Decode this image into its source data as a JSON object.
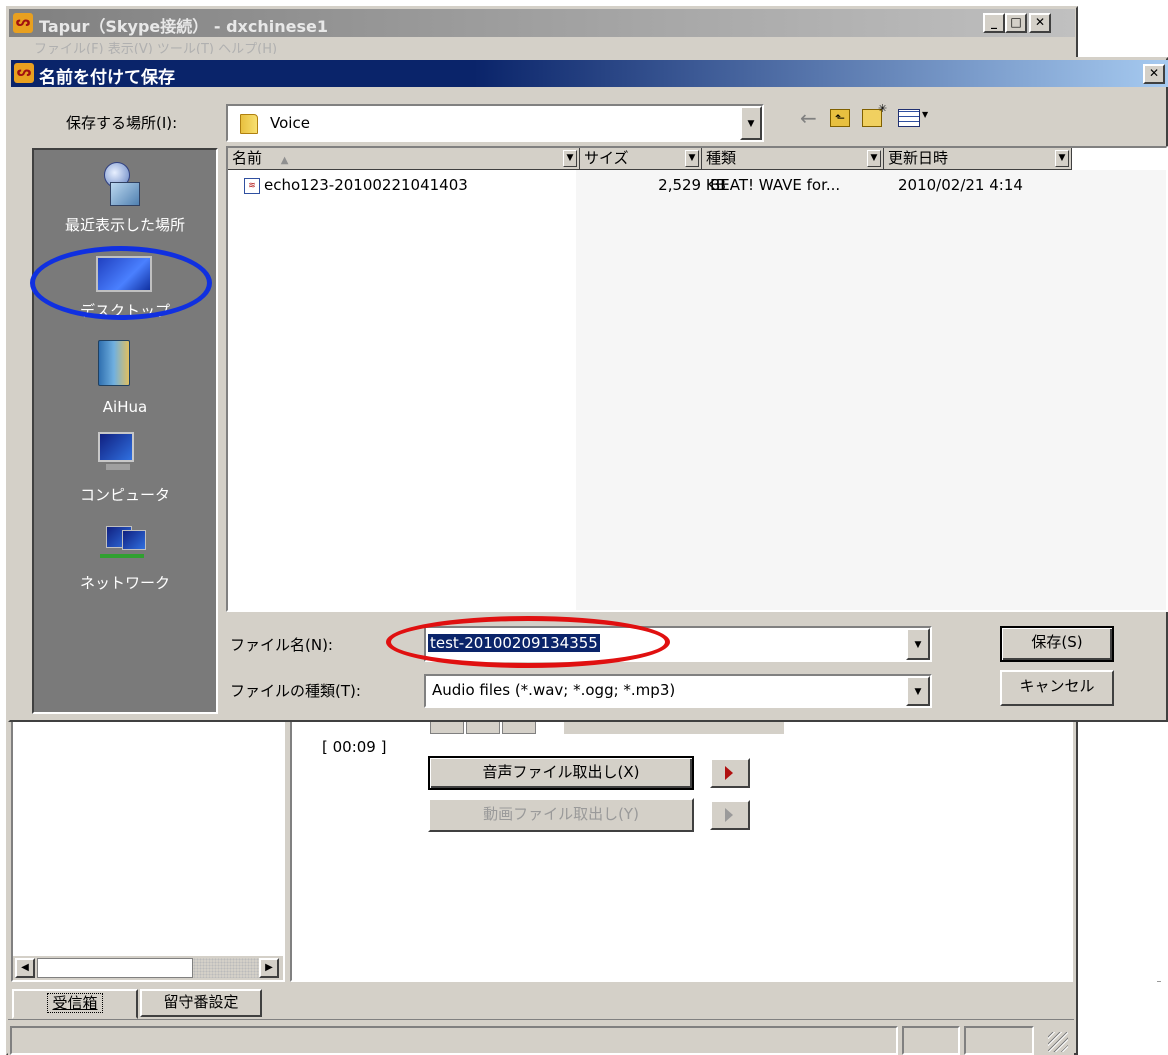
{
  "main_window": {
    "title": "Tapur（Skype接続） - dxchinese1",
    "menu_ghost": "ファイル(F)   表示(V)   ツール(T)   ヘルプ(H)",
    "time_label": "[ 00:09 ]",
    "extract_audio_label": "音声ファイル取出し(X)",
    "extract_video_label": "動画ファイル取出し(Y)",
    "tabs": [
      {
        "label": "受信箱"
      },
      {
        "label": "留守番設定"
      }
    ]
  },
  "dialog": {
    "title": "名前を付けて保存",
    "save_in_label": "保存する場所(I):",
    "save_in_value": "Voice",
    "places": [
      {
        "label": "最近表示した場所",
        "icon": "recent-places-icon"
      },
      {
        "label": "デスクトップ",
        "icon": "desktop-icon"
      },
      {
        "label": "AiHua",
        "icon": "user-folder-icon"
      },
      {
        "label": "コンピュータ",
        "icon": "computer-icon"
      },
      {
        "label": "ネットワーク",
        "icon": "network-icon"
      }
    ],
    "columns": [
      {
        "label": "名前"
      },
      {
        "label": "サイズ"
      },
      {
        "label": "種類"
      },
      {
        "label": "更新日時"
      }
    ],
    "files": [
      {
        "name": "echo123-20100221041403",
        "size": "2,529 KB",
        "type": "BEAT! WAVE for...",
        "date": "2010/02/21 4:14"
      }
    ],
    "filename_label": "ファイル名(N):",
    "filename_value": "test-20100209134355",
    "filetype_label": "ファイルの種類(T):",
    "filetype_value": "Audio files (*.wav; *.ogg; *.mp3)",
    "save_button": "保存(S)",
    "cancel_button": "キャンセル"
  },
  "colors": {
    "titlebar_start": "#0a246a",
    "titlebar_end": "#a6caf0",
    "places_bg": "#7a7a7a",
    "highlight": "#0a246a",
    "annotation_blue": "#1030e0",
    "annotation_red": "#e01010"
  }
}
